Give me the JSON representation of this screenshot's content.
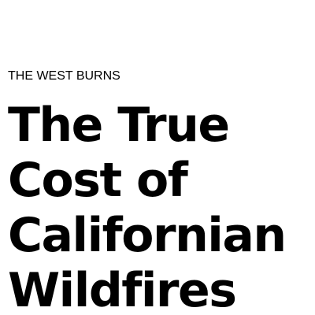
{
  "article": {
    "kicker": "THE WEST BURNS",
    "headline_lines": [
      "The True",
      "Cost of",
      "Californian",
      "Wildfires"
    ]
  },
  "colors": {
    "background": "#ffffff",
    "text": "#000000"
  }
}
